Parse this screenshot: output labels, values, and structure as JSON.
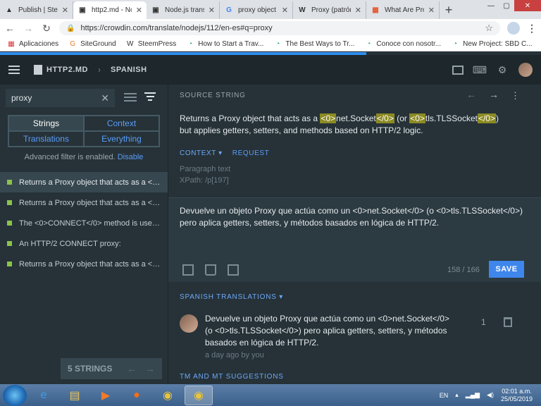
{
  "browser": {
    "tabs": [
      {
        "icon": "▲",
        "title": "Publish | Stee",
        "active": false
      },
      {
        "icon": "▣",
        "title": "http2.md - No",
        "active": true
      },
      {
        "icon": "▣",
        "title": "Node.js transl",
        "active": false
      },
      {
        "icon": "G",
        "title": "proxy object -",
        "active": false
      },
      {
        "icon": "W",
        "title": "Proxy (patrón",
        "active": false
      },
      {
        "icon": "▦",
        "title": "What Are Prox",
        "active": false
      }
    ],
    "url": "https://crowdin.com/translate/nodejs/112/en-es#q=proxy",
    "bookmarks": [
      {
        "icon": "▦",
        "label": "Aplicaciones"
      },
      {
        "icon": "G",
        "label": "SiteGround"
      },
      {
        "icon": "W",
        "label": "SteemPress"
      },
      {
        "icon": "◔",
        "label": "How to Start a Trav..."
      },
      {
        "icon": "◔",
        "label": "The Best Ways to Tr..."
      },
      {
        "icon": "◔",
        "label": "Conoce con nosotr..."
      },
      {
        "icon": "◔",
        "label": "New Project: SBD C..."
      }
    ],
    "bookmarks_more": "»"
  },
  "header": {
    "file": "HTTP2.MD",
    "separator": "›",
    "language": "SPANISH"
  },
  "sidebar": {
    "search_value": "proxy",
    "filters": [
      "Strings",
      "Context",
      "Translations",
      "Everything"
    ],
    "advanced_text": "Advanced filter is enabled.",
    "advanced_link": "Disable",
    "strings": [
      "Returns a Proxy object that acts as a <0>...",
      "Returns a Proxy object that acts as a <0>...",
      "The <0>CONNECT</0> method is used to...",
      "An HTTP/2 CONNECT proxy:",
      "Returns a Proxy object that acts as a <0>..."
    ],
    "count": "5 STRINGS"
  },
  "source": {
    "label": "SOURCE STRING",
    "text_parts": [
      {
        "t": "Returns a Proxy object that acts as a ",
        "tag": false
      },
      {
        "t": "<0>",
        "tag": true
      },
      {
        "t": "net.Socket",
        "tag": false
      },
      {
        "t": "</0>",
        "tag": true
      },
      {
        "t": " (or ",
        "tag": false
      },
      {
        "t": "<0>",
        "tag": true
      },
      {
        "t": "tls.TLSSocket",
        "tag": false
      },
      {
        "t": "</0>",
        "tag": true
      },
      {
        "t": ") but applies getters, setters, and methods based on HTTP/2 logic.",
        "tag": false
      }
    ],
    "context_tab": "CONTEXT ▾",
    "request_tab": "REQUEST",
    "context_line1": "Paragraph text",
    "context_line2": "XPath: /p[197]"
  },
  "translation": {
    "text": "Devuelve un objeto Proxy que actúa como un <0>net.Socket</0> (o <0>tls.TLSSocket</0>) pero aplica getters, setters, y métodos basados en lógica de HTTP/2.",
    "char_count": "158 / 166",
    "save_label": "SAVE"
  },
  "spanish_translations": {
    "title": "SPANISH TRANSLATIONS ▾",
    "text": "Devuelve un objeto Proxy que actúa como un <0>net.Socket</0> (o <0>tls.TLSSocket</0>) pero aplica getters, setters, y métodos basados en lógica de HTTP/2.",
    "meta": "a day ago by you",
    "votes": "1"
  },
  "tm_title": "TM AND MT SUGGESTIONS",
  "taskbar": {
    "lang": "EN",
    "time": "02:01 a.m.",
    "date": "25/05/2019"
  },
  "colors": {
    "accent": "#3f86ec",
    "tag_highlight": "#8c8a23",
    "approved_dot": "#8bc34a"
  }
}
